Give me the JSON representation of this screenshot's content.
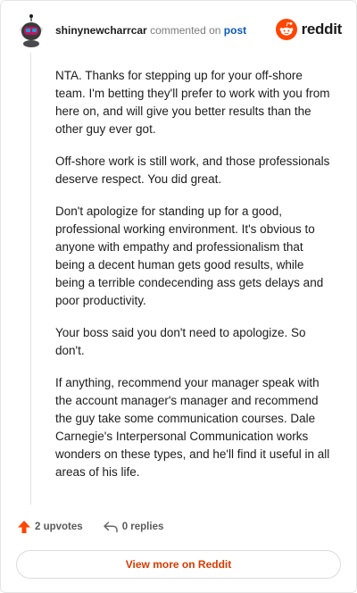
{
  "header": {
    "username": "shinynewcharrcar",
    "action": "commented on",
    "target": "post",
    "avatar_icon": "snoo-avatar-icon",
    "brand_icon": "reddit-logo-icon",
    "brand_name": "reddit",
    "brand_color": "#ff4500"
  },
  "comment": {
    "paragraphs": [
      "NTA. Thanks for stepping up for your off-shore team. I'm betting they'll prefer to work with you from here on, and will give you better results than the other guy ever got.",
      "Off-shore work is still work, and those professionals deserve respect. You did great.",
      "Don't apologize for standing up for a good, professional working environment. It's obvious to anyone with empathy and professionalism that being a decent human gets good results, while being a terrible condecending ass gets delays and poor productivity.",
      "Your boss said you don't need to apologize. So don't.",
      "If anything, recommend your manager speak with the account manager's manager and recommend the guy take some communication courses. Dale Carnegie's Interpersonal Communication works wonders on these types, and he'll find it useful in all areas of his life."
    ]
  },
  "footer": {
    "upvotes_label": "2 upvotes",
    "upvote_icon": "upvote-arrow-icon",
    "upvote_color": "#ff4500",
    "replies_label": "0 replies",
    "reply_icon": "reply-arrow-icon"
  },
  "cta": {
    "label": "View more on Reddit",
    "color": "#d93a00"
  }
}
